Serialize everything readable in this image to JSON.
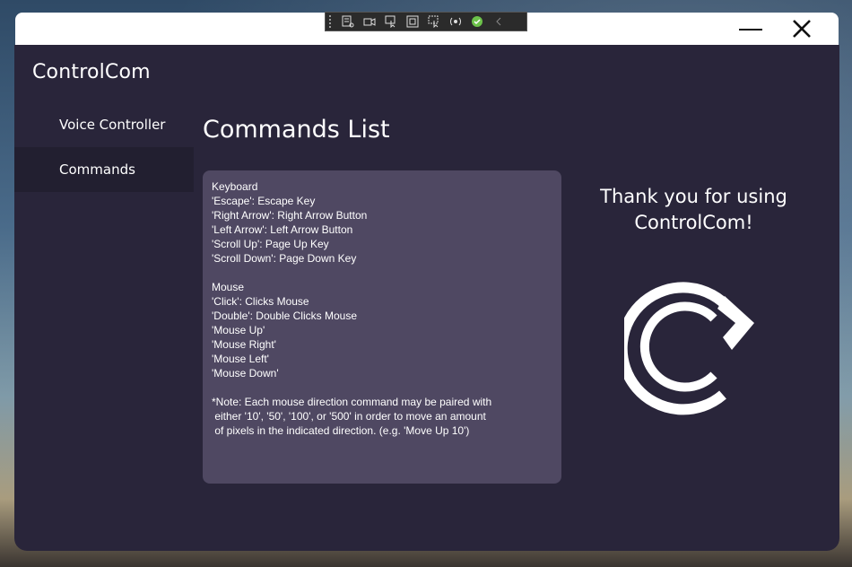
{
  "window": {
    "brand": "ControlCom",
    "minimize_icon": "minimize-icon",
    "close_icon": "close-icon"
  },
  "debug_toolbar": {
    "icons": [
      "live-visual-tree-icon",
      "video-icon",
      "select-element-icon",
      "display-layout-adorners-icon",
      "track-focus-icon",
      "hot-reload-icon",
      "status-check-icon",
      "collapse-chevron-icon"
    ]
  },
  "sidebar": {
    "items": [
      {
        "label": "Voice Controller",
        "active": false
      },
      {
        "label": "Commands",
        "active": true
      }
    ]
  },
  "main": {
    "title": "Commands List",
    "lines": [
      "Keyboard",
      "'Escape': Escape Key",
      "'Right Arrow': Right Arrow Button",
      "'Left Arrow': Left Arrow Button",
      "'Scroll Up': Page Up Key",
      "'Scroll Down': Page Down Key",
      "",
      "Mouse",
      "'Click': Clicks Mouse",
      "'Double': Double Clicks Mouse",
      "'Mouse Up'",
      "'Mouse Right'",
      "'Mouse Left'",
      "'Mouse Down'",
      "",
      "*Note: Each mouse direction command may be paired with",
      " either '10', '50', '100', or '500' in order to move an amount",
      " of pixels in the indicated direction. (e.g. 'Move Up 10')"
    ]
  },
  "thanks": {
    "line1": "Thank you for using",
    "line2": "ControlCom!"
  },
  "colors": {
    "app_bg": "#29253a",
    "sidebar_active": "#221f30",
    "panel_bg": "#4f4862",
    "text": "#ffffff"
  }
}
